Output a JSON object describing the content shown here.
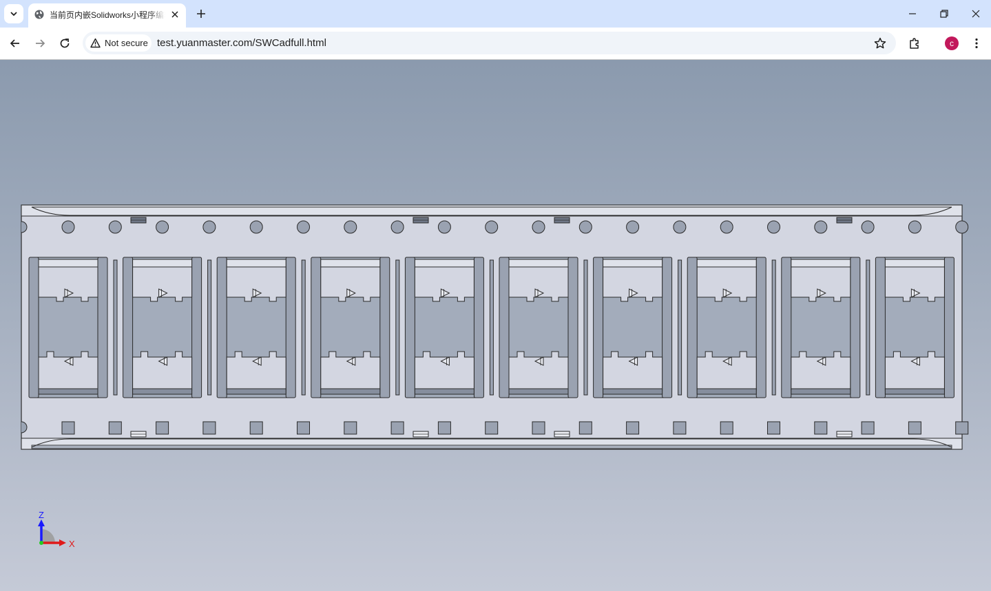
{
  "browser": {
    "tab": {
      "title": "当前页内嵌Solidworks小程序编辑器",
      "favicon": "globe-icon",
      "close_icon": "close-icon"
    },
    "new_tab_icon": "plus-icon",
    "window_controls": [
      "minimize-icon",
      "restore-icon",
      "close-icon"
    ],
    "toolbar": {
      "back_icon": "arrow-left-icon",
      "forward_icon": "arrow-right-icon",
      "reload_icon": "reload-icon",
      "security_label": "Not secure",
      "security_icon": "warning-triangle-icon",
      "url": "test.yuanmaster.com/SWCadfull.html",
      "bookmark_icon": "star-icon",
      "extensions_icon": "puzzle-icon",
      "profile_initial": "c",
      "menu_icon": "kebab-menu-icon"
    }
  },
  "viewer": {
    "part": {
      "cells": 10,
      "top_hole_count": 20,
      "bottom_square_count": 20,
      "top_slot_count": 4,
      "bottom_slot_count": 4
    },
    "triad": {
      "z_label": "Z",
      "x_label": "X"
    },
    "colors": {
      "part_face": "#d3d6e1",
      "part_dark": "#9aa2b1",
      "edge": "#2a2a2a",
      "z_axis": "#1a1aff",
      "x_axis": "#e01a1a",
      "origin": "#22cc22",
      "accent_tab": "#d3e3fd",
      "avatar": "#c2185b"
    }
  }
}
